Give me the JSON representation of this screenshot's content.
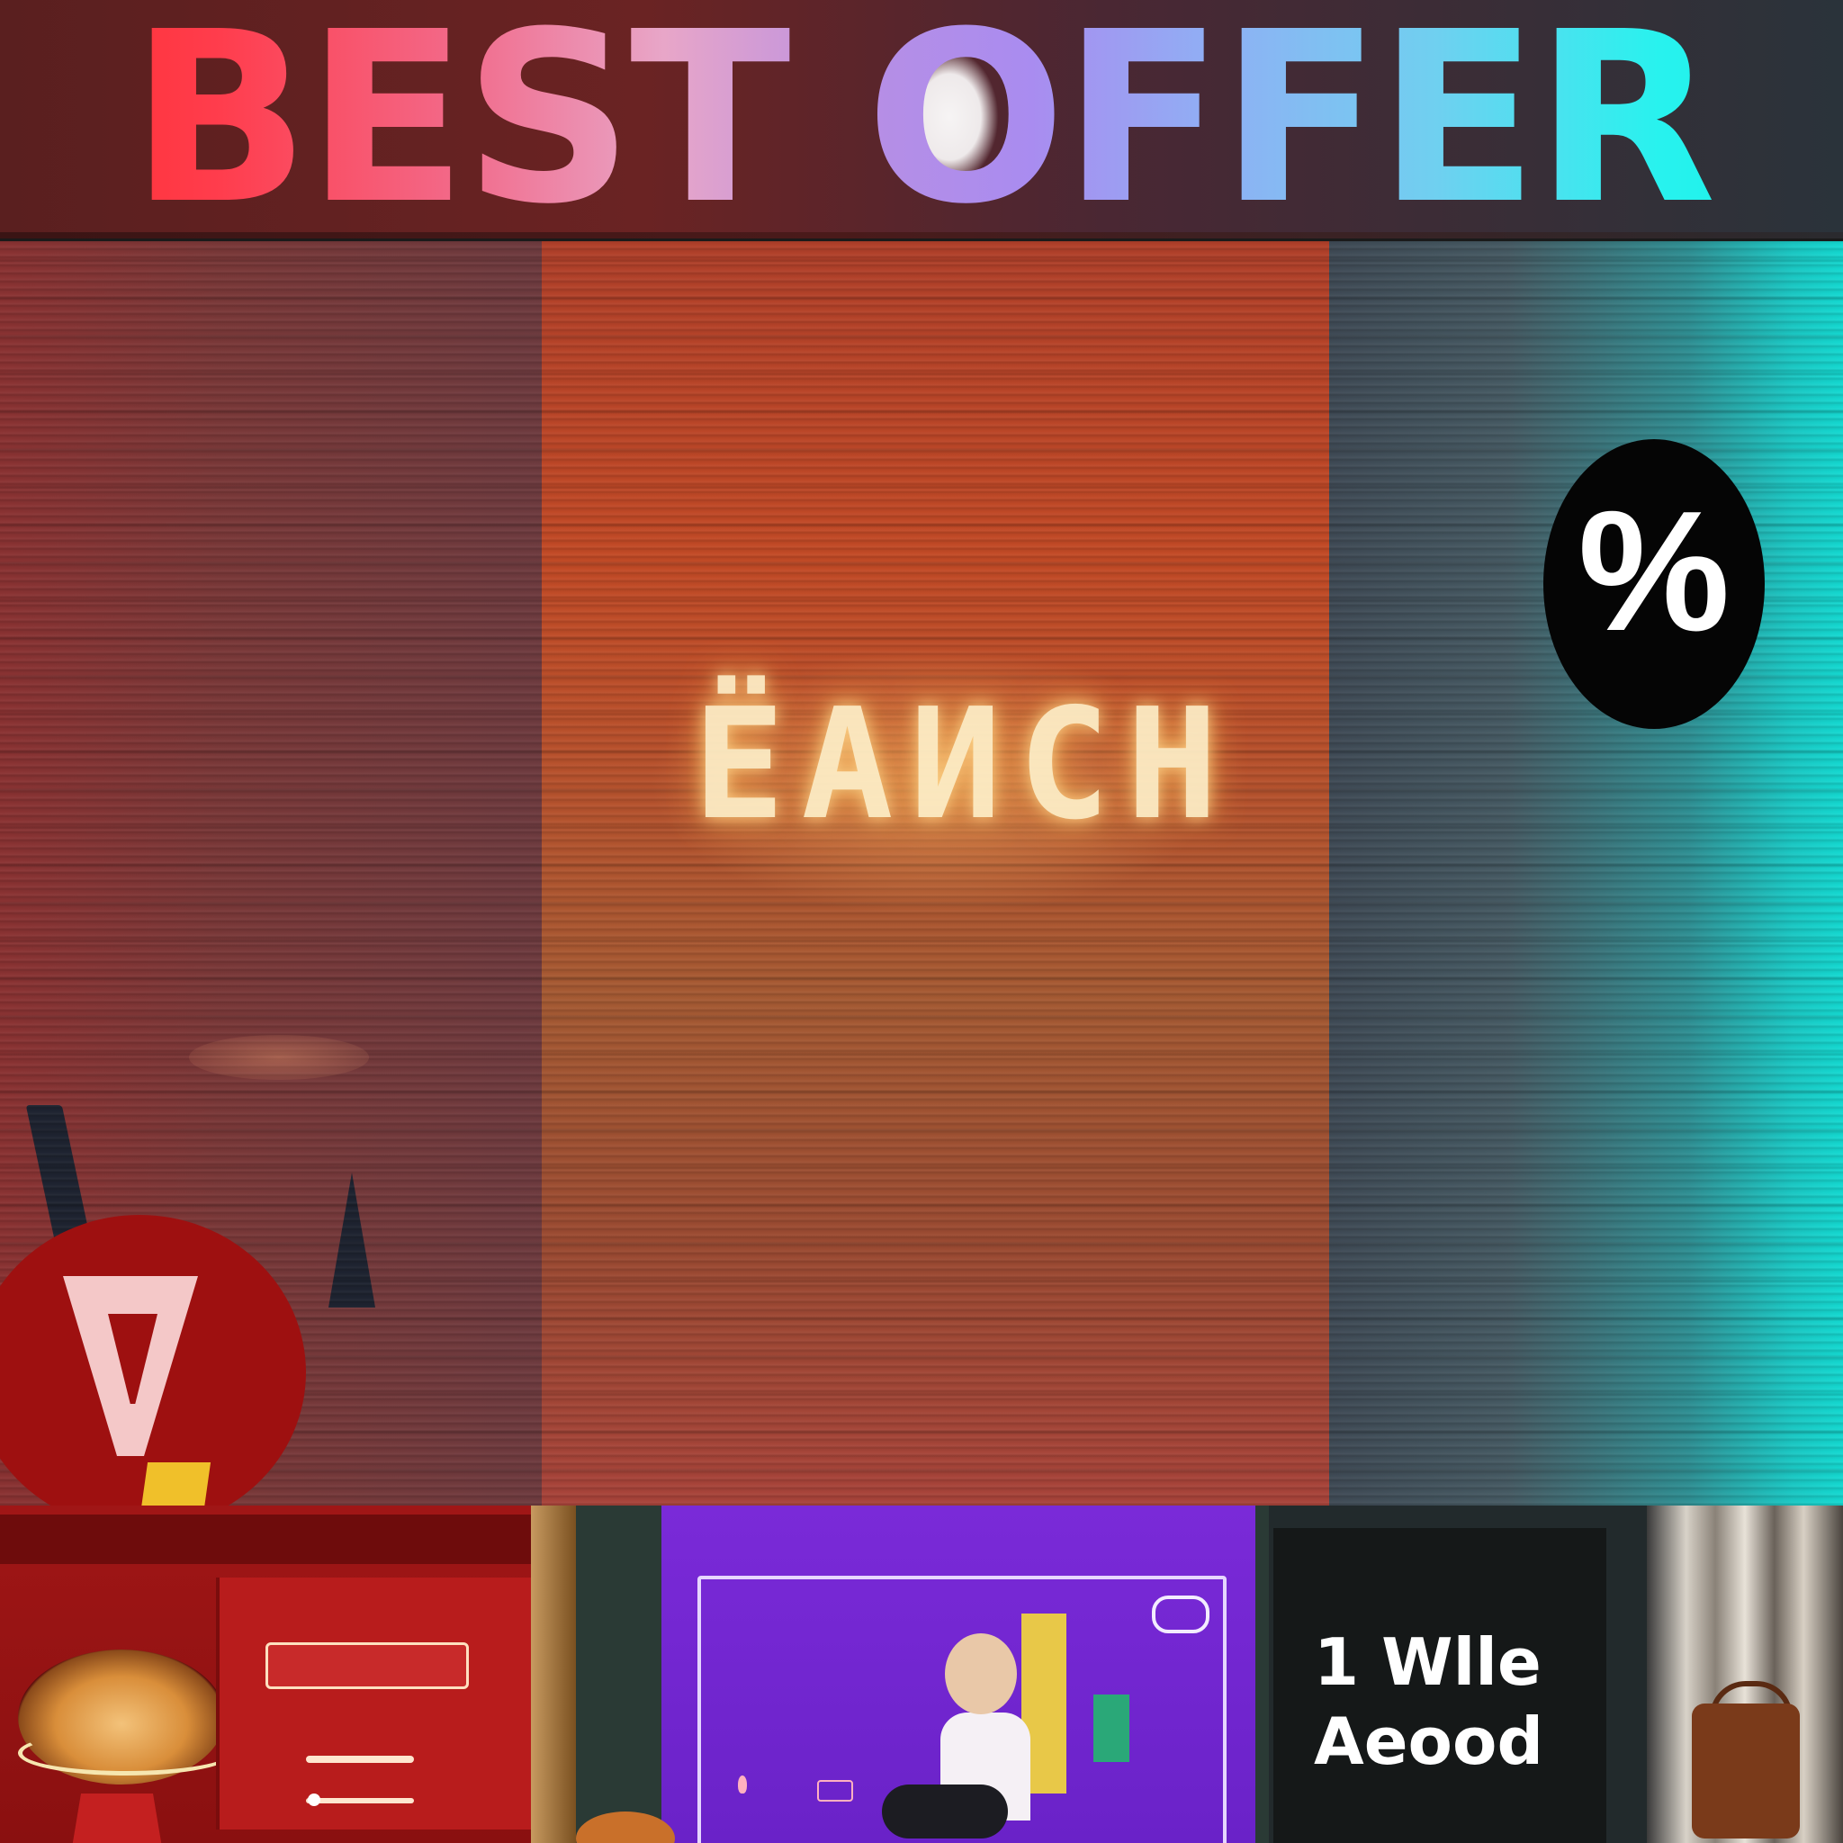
{
  "header": {
    "title": "BEST OFFER"
  },
  "badges": {
    "percent_symbol": "%"
  },
  "panels": {
    "middle_sign_text": "ЁАИСН"
  },
  "cards": {
    "dark_card_text": "1 Wlle\nAeood"
  },
  "icons": {
    "percent_badge": "percent-icon",
    "warning_badge": "warning-icon"
  },
  "colors": {
    "title_gradient_start": "#ff2a2a",
    "title_gradient_mid": "#a98cf0",
    "title_gradient_end": "#12f0e8",
    "percent_badge_bg": "#050505",
    "warning_badge_bg": "#9e1010",
    "purple_card": "#7a2ad8",
    "red_card": "#a01616"
  }
}
